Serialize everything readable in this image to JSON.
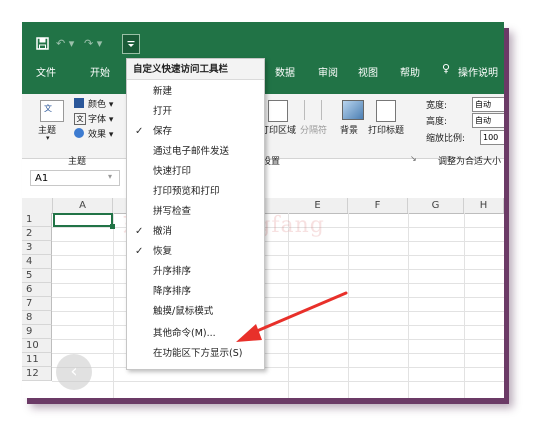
{
  "qat": {
    "save_icon": "save-icon",
    "undo_icon": "undo-icon",
    "redo_icon": "redo-icon",
    "customize_icon": "customize-qat-icon"
  },
  "tabs": [
    "文件",
    "开始",
    "数据",
    "审阅",
    "视图",
    "帮助",
    "操作说明"
  ],
  "ribbon": {
    "theme_group": {
      "theme_label": "主题",
      "colors": "颜色",
      "fonts": "字体",
      "effects": "效果",
      "group_label": "主题"
    },
    "page_setup": {
      "print_area": "打印区域",
      "breaks": "分隔符",
      "background": "背景",
      "print_titles": "打印标题",
      "group_label": "页面设置"
    },
    "scale_group": {
      "width": "宽度:",
      "height": "高度:",
      "width_value": "自动",
      "height_value": "自动",
      "scale": "缩放比例:",
      "scale_value": "100",
      "group_label": "调整为合适大小"
    }
  },
  "namebox": "A1",
  "columns": [
    "A",
    "E",
    "F",
    "G",
    "H"
  ],
  "rows": [
    "1",
    "2",
    "3",
    "4",
    "5",
    "6",
    "7",
    "8",
    "9",
    "10",
    "11",
    "12"
  ],
  "menu": {
    "title": "自定义快速访问工具栏",
    "items": [
      {
        "label": "新建",
        "checked": false
      },
      {
        "label": "打开",
        "checked": false
      },
      {
        "label": "保存",
        "checked": true
      },
      {
        "label": "通过电子邮件发送",
        "checked": false
      },
      {
        "label": "快速打印",
        "checked": false
      },
      {
        "label": "打印预览和打印",
        "checked": false
      },
      {
        "label": "拼写检查",
        "checked": false
      },
      {
        "label": "撤消",
        "checked": true
      },
      {
        "label": "恢复",
        "checked": true
      },
      {
        "label": "升序排序",
        "checked": false
      },
      {
        "label": "降序排序",
        "checked": false
      },
      {
        "label": "触摸/鼠标模式",
        "checked": false
      },
      {
        "label": "其他命令(M)...",
        "checked": false
      },
      {
        "label": "在功能区下方显示(S)",
        "checked": false
      }
    ]
  },
  "watermark": "东方yundongfang",
  "colors": {
    "excel_green": "#217346",
    "arrow_red": "#e8302a",
    "frame_shadow": "#6b3a66"
  }
}
